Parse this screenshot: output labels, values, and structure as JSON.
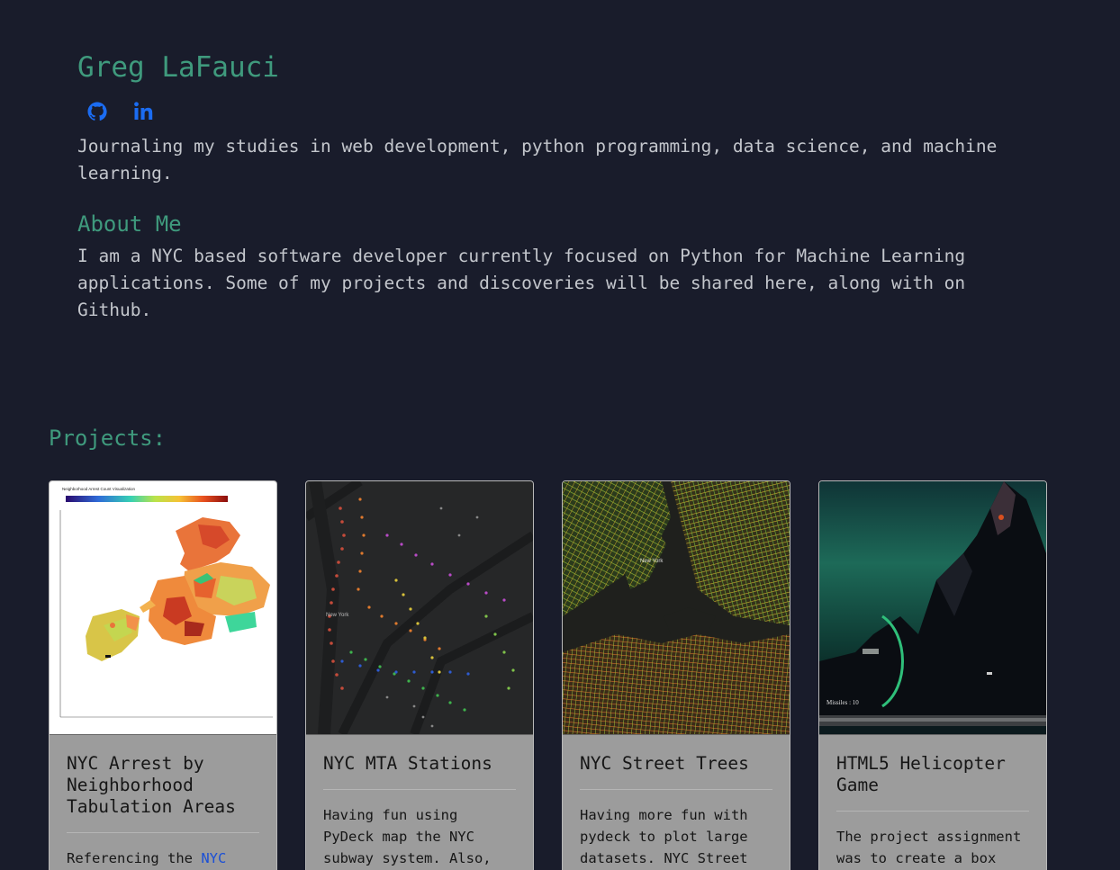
{
  "header": {
    "name": "Greg LaFauci",
    "tagline": "Journaling my studies in web development, python programming, data science, and machine learning."
  },
  "socials": [
    {
      "icon": "github-icon",
      "color": "#1b6cf2"
    },
    {
      "icon": "linkedin-icon",
      "color": "#1b6cf2"
    }
  ],
  "about": {
    "heading": "About Me",
    "text": "I am a NYC based software developer currently focused on Python for Machine Learning applications. Some of my projects and discoveries will be shared here, along with on Github."
  },
  "projects": {
    "heading": "Projects:",
    "cards": [
      {
        "title": "NYC Arrest by Neighborhood Tabulation Areas",
        "text_prefix": "Referencing the ",
        "text_link": "NYC",
        "image_label": "Neighborhood Arrest Count Visualization"
      },
      {
        "title": "NYC MTA Stations",
        "text": "Having fun using PyDeck map the NYC subway system. Also,",
        "image_label": "New York"
      },
      {
        "title": "NYC Street Trees",
        "text": "Having more fun with pydeck to plot large datasets. NYC Street",
        "image_label": "New York"
      },
      {
        "title": "HTML5 Helicopter Game",
        "text": "The project assignment was to create a box",
        "image_label": "Missiles : 10"
      }
    ]
  },
  "colors": {
    "background": "#191c2b",
    "accent": "#3f9a7d",
    "link": "#1a4fd6",
    "card": "#9c9c9c"
  }
}
